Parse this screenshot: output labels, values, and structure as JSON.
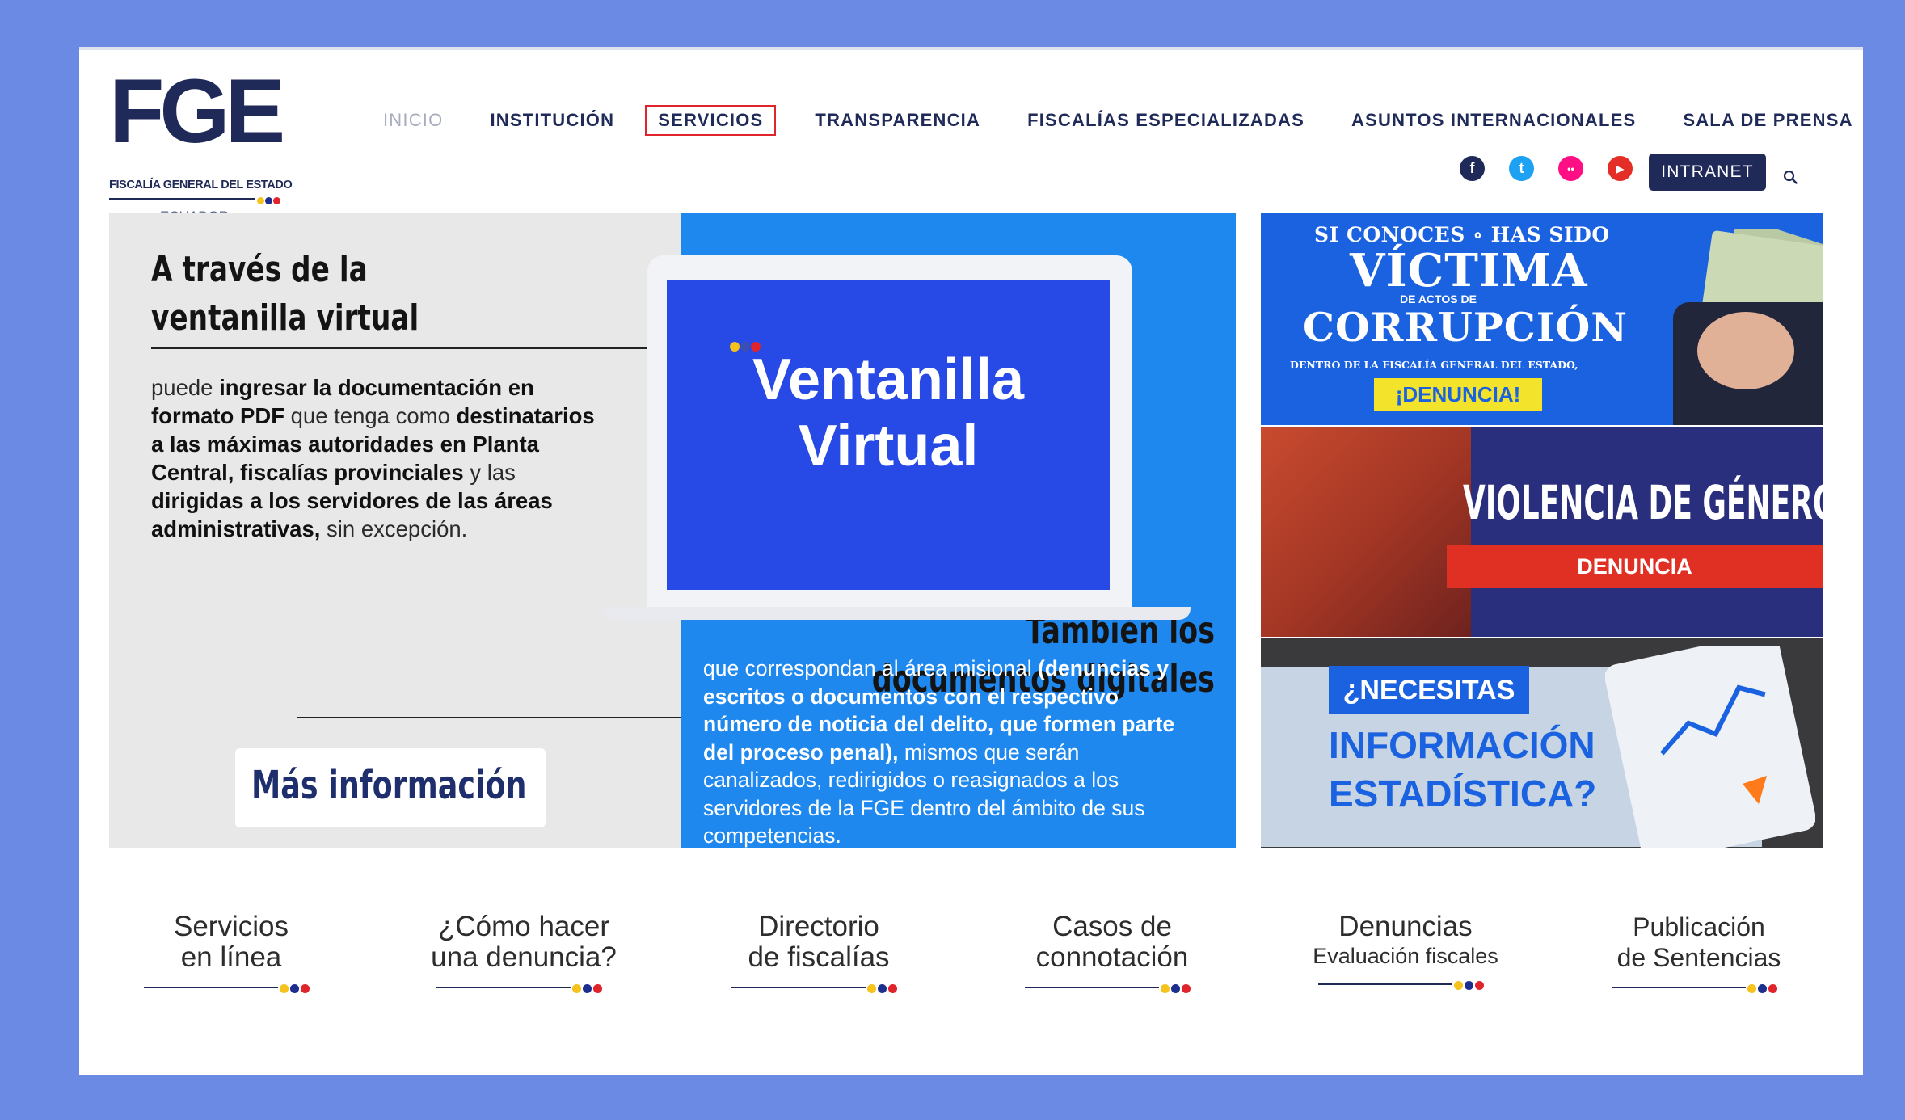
{
  "logo": {
    "word": "FGE",
    "subtitle": "FISCALÍA GENERAL DEL ESTADO",
    "country": "ECUADOR"
  },
  "nav": {
    "items": [
      "INICIO",
      "INSTITUCIÓN",
      "SERVICIOS",
      "TRANSPARENCIA",
      "FISCALÍAS ESPECIALIZADAS",
      "ASUNTOS INTERNACIONALES",
      "SALA DE PRENSA"
    ],
    "highlighted": "SERVICIOS"
  },
  "social": {
    "icons": [
      "facebook-icon",
      "twitter-icon",
      "flickr-icon",
      "youtube-icon"
    ],
    "fb_glyph": "f",
    "tw_glyph": "t",
    "fl_glyph": "••",
    "yt_glyph": "▶",
    "intranet": "INTRANET"
  },
  "hero": {
    "title_line1": "A través de la",
    "title_line2": "ventanilla virtual",
    "body_html": "puede <b>ingresar la documentación en formato PDF</b> que tenga como <b>destinatarios a las máximas autoridades en Planta Central, fiscalías provinciales</b> y las <b>dirigidas a los servidores de las áreas administrativas,</b> sin excepción.",
    "sub_line1": "También los",
    "sub_line2": "documentos digitales",
    "more_button": "Más información",
    "screen_line1": "Ventanilla",
    "screen_line2": "Virtual",
    "right_body_html": "que correspondan al área misional <b>(denuncias y escritos o documentos con el respectivo número de noticia del delito, que formen parte del proceso penal),</b> mismos que serán canalizados, redirigidos o reasignados a los servidores de la FGE dentro del ámbito de sus competencias."
  },
  "banners": {
    "corruption": {
      "top": "SI CONOCES  ∘  HAS SIDO",
      "big": "VÍCTIMA",
      "small": "DE ACTOS DE",
      "big2": "CORRUPCIÓN",
      "line": "DENTRO DE LA FISCALÍA GENERAL DEL ESTADO,",
      "button": "¡DENUNCIA!"
    },
    "gender": {
      "title": "VIOLENCIA DE GÉNERO",
      "bar": "DENUNCIA"
    },
    "stats": {
      "tag": "¿NECESITAS",
      "line1": "INFORMACIÓN",
      "line2": "ESTADÍSTICA?"
    }
  },
  "quick_links": [
    {
      "t1": "Servicios",
      "t2": "en línea"
    },
    {
      "t1": "¿Cómo hacer",
      "t2": "una denuncia?"
    },
    {
      "t1": "Directorio",
      "t2": "de fiscalías"
    },
    {
      "t1": "Casos de",
      "t2": "connotación"
    },
    {
      "t1": "Denuncias",
      "t2": "Evaluación fiscales"
    },
    {
      "t1": "Publicación",
      "t2": "de Sentencias"
    }
  ],
  "colors": {
    "navy": "#1f2a59",
    "accent_red": "#e0242b",
    "blue": "#1e88ef",
    "frame": "#6a8ae4"
  }
}
